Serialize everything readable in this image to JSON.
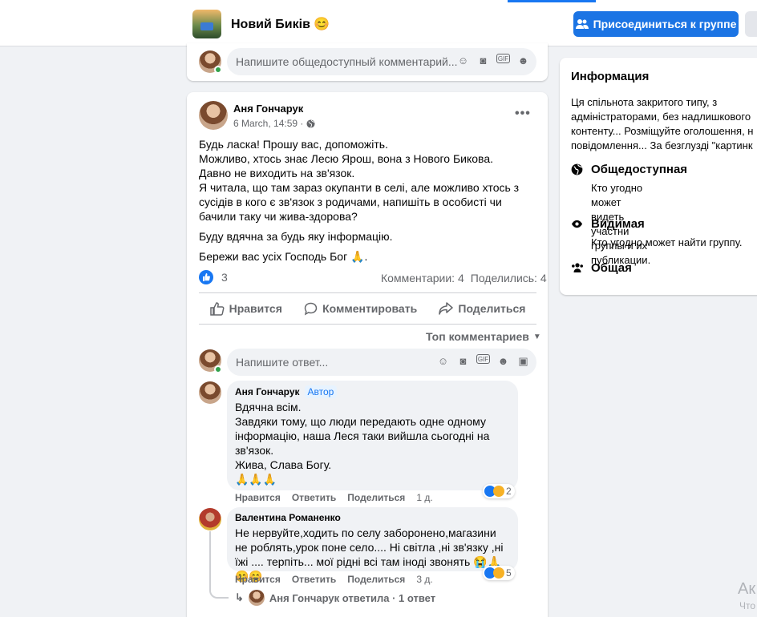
{
  "header": {
    "group_name": "Новий Биків 😊",
    "join_label": "Присоединиться к группе"
  },
  "top_comment_box": {
    "placeholder": "Напишите общедоступный комментарий..."
  },
  "post": {
    "author": "Аня Гончарук",
    "timestamp": "6 March, 14:59 ·",
    "paragraphs": [
      "Будь ласка! Прошу вас, допоможіть.\nМожливо, хтось знає Лесю Ярош, вона з Нового Бикова.\nДавно не виходить на зв'язок.\nЯ читала, що там зараз окупанти в селі, але можливо хтось з сусідів в кого є зв'язок з родичами, напишіть в особисті чи бачили таку чи жива-здорова?",
      "Буду вдячна за будь яку інформацію.",
      "Бережи вас усіх Господь Бог 🙏."
    ],
    "reaction_count": "3",
    "comments_count": "Комментарии: 4",
    "shares_count": "Поделились: 4",
    "actions": {
      "like": "Нравится",
      "comment": "Комментировать",
      "share": "Поделиться"
    },
    "sort_label": "Топ комментариев",
    "reply_placeholder": "Напишите ответ..."
  },
  "comments": [
    {
      "author": "Аня Гончарук",
      "badge": "Автор",
      "text": "Вдячна всім.\nЗавдяки тому, що люди передають одне одному інформацію, наша Леся таки вийшла сьогодні на зв'язок.\nЖива, Слава Богу.\n🙏🙏🙏",
      "like": "Нравится",
      "reply": "Ответить",
      "share": "Поделиться",
      "time": "1 д.",
      "reactions": "2"
    },
    {
      "author": "Валентина Романенко",
      "text": "Не нервуйте,ходить по селу заборонено,магазини не роблять,урок поне село.... Ні світла ,ні зв'язку ,ні їжі .... терпіть... мої рідні всі там іноді звонять 😭🙏😊😊",
      "like": "Нравится",
      "reply": "Ответить",
      "share": "Поделиться",
      "time": "3 д.",
      "reactions": "5",
      "reply_summary": "Аня Гончарук ответила · 1 ответ"
    }
  ],
  "sidebar": {
    "title": "Информация",
    "description": "Ця спільнота закритого типу, з\nадміністраторами, без надлишкового\nконтенту... Розміщуйте оголошення, н\nповідомлення... За безглузді \"картинк",
    "rows": [
      {
        "icon": "globe-icon",
        "heading": "Общедоступная",
        "sub": "Кто угодно может видеть участни\nгруппы и их публикации."
      },
      {
        "icon": "eye-icon",
        "heading": "Видимая",
        "sub": "Кто угодно может найти группу."
      },
      {
        "icon": "people-icon",
        "heading": "Общая",
        "sub": ""
      }
    ]
  },
  "watermark": {
    "line1": "Ак",
    "line2": "Что"
  },
  "colors": {
    "accent": "#1877f2",
    "join_button": "#1b74e4",
    "page_bg": "#f0f2f5"
  }
}
